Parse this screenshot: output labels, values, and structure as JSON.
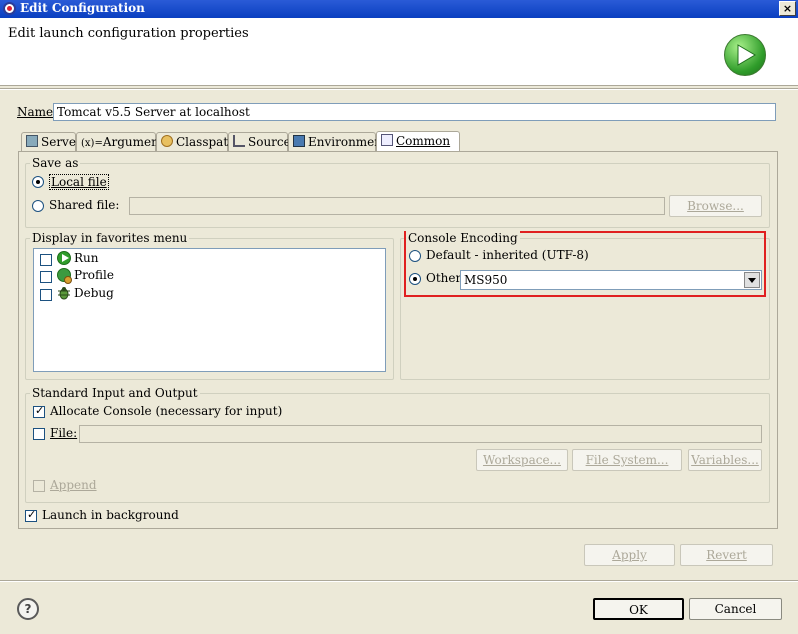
{
  "window": {
    "title": "Edit Configuration",
    "close_glyph": "×"
  },
  "header": {
    "title": "Edit launch configuration properties",
    "icon": "run-launch-icon"
  },
  "name_field": {
    "label": "Name:",
    "value": "Tomcat v5.5 Server at localhost"
  },
  "tabs": [
    {
      "label": "Server",
      "icon": "server-icon"
    },
    {
      "label": "Arguments",
      "icon": "arguments-icon",
      "prefix": "(x)="
    },
    {
      "label": "Classpath",
      "icon": "classpath-icon"
    },
    {
      "label": "Source",
      "icon": "source-icon"
    },
    {
      "label": "Environment",
      "icon": "environment-icon"
    },
    {
      "label": "Common",
      "icon": "common-icon",
      "active": true
    }
  ],
  "save_as": {
    "title": "Save as",
    "local_file": "Local file",
    "shared_file": "Shared file:",
    "shared_value": "",
    "browse": "Browse..."
  },
  "favorites": {
    "title": "Display in favorites menu",
    "items": [
      {
        "label": "Run",
        "icon": "run-icon"
      },
      {
        "label": "Profile",
        "icon": "profile-icon"
      },
      {
        "label": "Debug",
        "icon": "debug-icon"
      }
    ]
  },
  "encoding": {
    "title": "Console Encoding",
    "default_label": "Default - inherited (UTF-8)",
    "other_label": "Other",
    "other_value": "MS950",
    "highlight_color": "#e02020"
  },
  "std_io": {
    "title": "Standard Input and Output",
    "allocate_console": "Allocate Console (necessary for input)",
    "file_label": "File:",
    "file_value": "",
    "workspace": "Workspace...",
    "file_system": "File System...",
    "variables": "Variables...",
    "append": "Append"
  },
  "launch_background": "Launch in background",
  "actions": {
    "apply": "Apply",
    "revert": "Revert",
    "ok": "OK",
    "cancel": "Cancel"
  },
  "help": {
    "glyph": "?"
  }
}
